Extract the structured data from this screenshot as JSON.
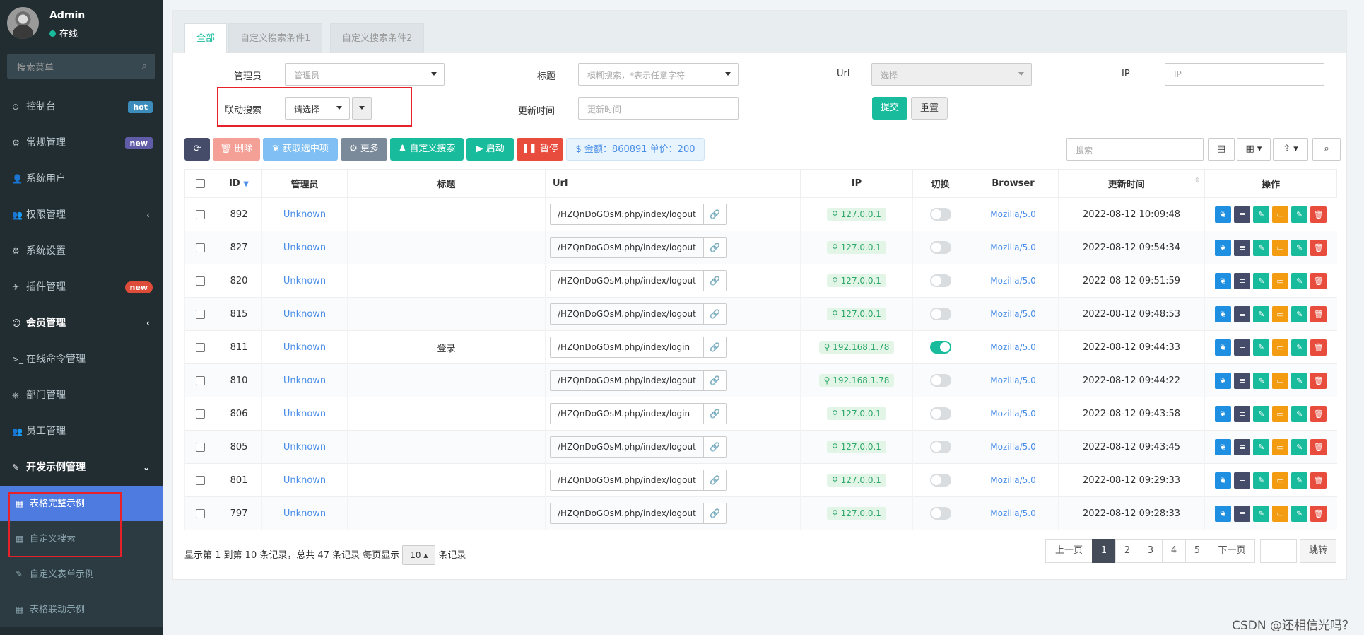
{
  "sidebar": {
    "user": {
      "name": "Admin",
      "status": "在线"
    },
    "search_placeholder": "搜索菜单",
    "items": [
      {
        "label": "控制台",
        "badge": "hot"
      },
      {
        "label": "常规管理",
        "badge": "new"
      },
      {
        "label": "系统用户"
      },
      {
        "label": "权限管理",
        "arrow": "‹"
      },
      {
        "label": "系统设置"
      },
      {
        "label": "插件管理",
        "badge": "new"
      },
      {
        "label": "会员管理",
        "arrow": "‹"
      },
      {
        "label": "在线命令管理"
      },
      {
        "label": "部门管理"
      },
      {
        "label": "员工管理"
      },
      {
        "label": "开发示例管理",
        "arrow": "⌄"
      }
    ],
    "sub_items": [
      {
        "label": "表格完整示例"
      },
      {
        "label": "自定义搜索"
      },
      {
        "label": "自定义表单示例"
      },
      {
        "label": "表格联动示例"
      }
    ]
  },
  "tabs": [
    "全部",
    "自定义搜索条件1",
    "自定义搜索条件2"
  ],
  "filters": {
    "admin_label": "管理员",
    "admin_placeholder": "管理员",
    "title_label": "标题",
    "title_placeholder": "模糊搜索，*表示任意字符",
    "url_label": "Url",
    "url_placeholder": "选择",
    "ip_label": "IP",
    "ip_placeholder": "IP",
    "linked_label": "联动搜索",
    "linked_value": "请选择",
    "time_label": "更新时间",
    "time_placeholder": "更新时间",
    "submit": "提交",
    "reset": "重置"
  },
  "toolbar": {
    "delete": "删除",
    "get_selected": "获取选中项",
    "more": "更多",
    "custom_search": "自定义搜索",
    "start": "启动",
    "pause": "暂停",
    "amount": "金额：860891 单价：200",
    "search_placeholder": "搜索"
  },
  "table": {
    "headers": [
      "ID",
      "管理员",
      "标题",
      "Url",
      "IP",
      "切换",
      "Browser",
      "更新时间",
      "操作"
    ],
    "rows": [
      {
        "id": "892",
        "admin": "Unknown",
        "title": "",
        "url": "/HZQnDoGOsM.php/index/logout",
        "ip": "127.0.0.1",
        "on": false,
        "browser": "Mozilla/5.0",
        "time": "2022-08-12 10:09:48"
      },
      {
        "id": "827",
        "admin": "Unknown",
        "title": "",
        "url": "/HZQnDoGOsM.php/index/logout",
        "ip": "127.0.0.1",
        "on": false,
        "browser": "Mozilla/5.0",
        "time": "2022-08-12 09:54:34"
      },
      {
        "id": "820",
        "admin": "Unknown",
        "title": "",
        "url": "/HZQnDoGOsM.php/index/logout",
        "ip": "127.0.0.1",
        "on": false,
        "browser": "Mozilla/5.0",
        "time": "2022-08-12 09:51:59"
      },
      {
        "id": "815",
        "admin": "Unknown",
        "title": "",
        "url": "/HZQnDoGOsM.php/index/logout",
        "ip": "127.0.0.1",
        "on": false,
        "browser": "Mozilla/5.0",
        "time": "2022-08-12 09:48:53"
      },
      {
        "id": "811",
        "admin": "Unknown",
        "title": "登录",
        "url": "/HZQnDoGOsM.php/index/login",
        "ip": "192.168.1.78",
        "on": true,
        "browser": "Mozilla/5.0",
        "time": "2022-08-12 09:44:33"
      },
      {
        "id": "810",
        "admin": "Unknown",
        "title": "",
        "url": "/HZQnDoGOsM.php/index/logout",
        "ip": "192.168.1.78",
        "on": false,
        "browser": "Mozilla/5.0",
        "time": "2022-08-12 09:44:22"
      },
      {
        "id": "806",
        "admin": "Unknown",
        "title": "",
        "url": "/HZQnDoGOsM.php/index/login",
        "ip": "127.0.0.1",
        "on": false,
        "browser": "Mozilla/5.0",
        "time": "2022-08-12 09:43:58"
      },
      {
        "id": "805",
        "admin": "Unknown",
        "title": "",
        "url": "/HZQnDoGOsM.php/index/logout",
        "ip": "127.0.0.1",
        "on": false,
        "browser": "Mozilla/5.0",
        "time": "2022-08-12 09:43:45"
      },
      {
        "id": "801",
        "admin": "Unknown",
        "title": "",
        "url": "/HZQnDoGOsM.php/index/logout",
        "ip": "127.0.0.1",
        "on": false,
        "browser": "Mozilla/5.0",
        "time": "2022-08-12 09:29:33"
      },
      {
        "id": "797",
        "admin": "Unknown",
        "title": "",
        "url": "/HZQnDoGOsM.php/index/logout",
        "ip": "127.0.0.1",
        "on": false,
        "browser": "Mozilla/5.0",
        "time": "2022-08-12 09:28:33"
      }
    ]
  },
  "pagination": {
    "info_prefix": "显示第 1 到第 10 条记录，总共 47 条记录 每页显示",
    "page_size": "10",
    "info_suffix": "条记录",
    "prev": "上一页",
    "pages": [
      "1",
      "2",
      "3",
      "4",
      "5"
    ],
    "current": "1",
    "next": "下一页",
    "jump": "跳转"
  },
  "watermark": "CSDN @还相信光吗？",
  "colors": {
    "sidebar_bg": "#222d32",
    "accent": "#18bc9c",
    "active_menu": "#4e7be0",
    "highlight_box": "#e6212a"
  }
}
